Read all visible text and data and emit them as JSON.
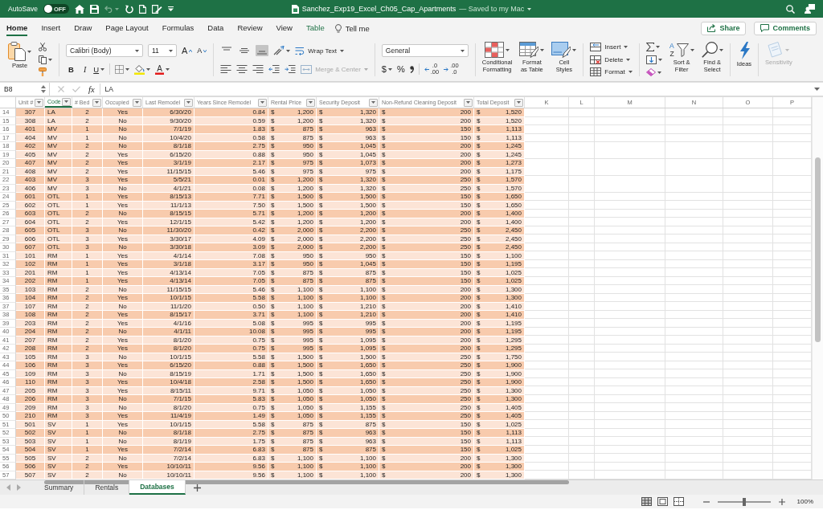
{
  "title_bar": {
    "autosave": {
      "label": "AutoSave",
      "on": false,
      "state_text": "OFF"
    },
    "quick_access": [
      {
        "disabled": false
      },
      {
        "disabled": false
      },
      {
        "disabled": true
      },
      {
        "disabled": false
      },
      {
        "disabled": false
      },
      {
        "disabled": false
      }
    ],
    "document_name": "Sanchez_Exp19_Excel_Ch05_Cap_Apartments",
    "save_status": "— Saved to my Mac"
  },
  "ribbon_tabs": [
    {
      "label": "Home",
      "selected": true,
      "kind": "standard"
    },
    {
      "label": "Insert",
      "selected": false,
      "kind": "standard"
    },
    {
      "label": "Draw",
      "selected": false,
      "kind": "standard"
    },
    {
      "label": "Page Layout",
      "selected": false,
      "kind": "standard"
    },
    {
      "label": "Formulas",
      "selected": false,
      "kind": "standard"
    },
    {
      "label": "Data",
      "selected": false,
      "kind": "standard"
    },
    {
      "label": "Review",
      "selected": false,
      "kind": "standard"
    },
    {
      "label": "View",
      "selected": false,
      "kind": "standard"
    },
    {
      "label": "Table",
      "selected": false,
      "kind": "contextual"
    }
  ],
  "tell_me": "Tell me",
  "share": "Share",
  "comments": "Comments",
  "ribbon": {
    "clipboard": {
      "paste": "Paste"
    },
    "font": {
      "name": "Calibri (Body)",
      "size": "11",
      "grow": "A",
      "shrink": "A",
      "bold": "B",
      "italic": "I",
      "underline": "U",
      "font_color": "A"
    },
    "alignment": {
      "vertical": [
        {
          "selected": false
        },
        {
          "selected": false
        },
        {
          "selected": true
        }
      ],
      "wrap_text": "Wrap Text",
      "merge": {
        "label": "Merge & Center",
        "disabled": true
      }
    },
    "number": {
      "format": "General",
      "currency": "$",
      "percent": "%",
      "decimals": [
        {
          "lines": [
            ".0",
            ".00"
          ]
        },
        {
          "lines": [
            ".00",
            ".0"
          ]
        }
      ]
    },
    "styles": [
      {
        "lines": [
          "Conditional",
          "Formatting"
        ]
      },
      {
        "lines": [
          "Format",
          "as Table"
        ]
      },
      {
        "lines": [
          "Cell",
          "Styles"
        ]
      }
    ],
    "cells": [
      "Insert",
      "Delete",
      "Format"
    ],
    "editing": {
      "sort_letters": [
        "A",
        "Z"
      ],
      "sort": [
        "Sort &",
        "Filter"
      ],
      "find": [
        "Find &",
        "Select"
      ]
    },
    "ideas": "Ideas",
    "sensitivity": {
      "label": "Sensitivity",
      "disabled": true
    }
  },
  "formula_bar": {
    "name_box": "B8",
    "actions": [
      {
        "disabled": true
      },
      {
        "disabled": true
      }
    ],
    "function_label": "fx",
    "formula": "LA"
  },
  "sheet": {
    "columns": [
      {
        "label": "Unit #",
        "kind": "id",
        "selected": false
      },
      {
        "label": "Code",
        "kind": "code",
        "selected": true
      },
      {
        "label": "# Bed",
        "kind": "count",
        "selected": false
      },
      {
        "label": "Occupied",
        "kind": "flag",
        "selected": false
      },
      {
        "label": "Last Remodel",
        "kind": "date",
        "selected": false
      },
      {
        "label": "Years Since Remodel",
        "kind": "decimal",
        "selected": false
      },
      {
        "label": "Rental Price",
        "kind": "currency",
        "selected": false
      },
      {
        "label": "Security Deposit",
        "kind": "currency",
        "selected": false
      },
      {
        "label": "Non-Refund Cleaning Deposit",
        "kind": "currency",
        "selected": false
      },
      {
        "label": "Total Deposit",
        "kind": "currency",
        "selected": false
      }
    ],
    "extra_columns": [
      "K",
      "L",
      "M",
      "N",
      "O",
      "P"
    ],
    "rows": [
      {
        "header": "14",
        "cells": [
          "307",
          "LA",
          "2",
          "Yes",
          "6/30/20",
          "0.84",
          [
            "$",
            "1,200"
          ],
          [
            "$",
            "1,320"
          ],
          [
            "$",
            "200"
          ],
          [
            "$",
            "1,520"
          ]
        ]
      },
      {
        "header": "15",
        "cells": [
          "308",
          "LA",
          "2",
          "No",
          "9/30/20",
          "0.59",
          [
            "$",
            "1,200"
          ],
          [
            "$",
            "1,320"
          ],
          [
            "$",
            "200"
          ],
          [
            "$",
            "1,520"
          ]
        ]
      },
      {
        "header": "16",
        "cells": [
          "401",
          "MV",
          "1",
          "No",
          "7/1/19",
          "1.83",
          [
            "$",
            "875"
          ],
          [
            "$",
            "963"
          ],
          [
            "$",
            "150"
          ],
          [
            "$",
            "1,113"
          ]
        ]
      },
      {
        "header": "17",
        "cells": [
          "404",
          "MV",
          "1",
          "No",
          "10/4/20",
          "0.58",
          [
            "$",
            "875"
          ],
          [
            "$",
            "963"
          ],
          [
            "$",
            "150"
          ],
          [
            "$",
            "1,113"
          ]
        ]
      },
      {
        "header": "18",
        "cells": [
          "402",
          "MV",
          "2",
          "No",
          "8/1/18",
          "2.75",
          [
            "$",
            "950"
          ],
          [
            "$",
            "1,045"
          ],
          [
            "$",
            "200"
          ],
          [
            "$",
            "1,245"
          ]
        ]
      },
      {
        "header": "19",
        "cells": [
          "405",
          "MV",
          "2",
          "Yes",
          "6/15/20",
          "0.88",
          [
            "$",
            "950"
          ],
          [
            "$",
            "1,045"
          ],
          [
            "$",
            "200"
          ],
          [
            "$",
            "1,245"
          ]
        ]
      },
      {
        "header": "20",
        "cells": [
          "407",
          "MV",
          "2",
          "Yes",
          "3/1/19",
          "2.17",
          [
            "$",
            "975"
          ],
          [
            "$",
            "1,073"
          ],
          [
            "$",
            "200"
          ],
          [
            "$",
            "1,273"
          ]
        ]
      },
      {
        "header": "21",
        "cells": [
          "408",
          "MV",
          "2",
          "Yes",
          "11/15/15",
          "5.46",
          [
            "$",
            "975"
          ],
          [
            "$",
            "975"
          ],
          [
            "$",
            "200"
          ],
          [
            "$",
            "1,175"
          ]
        ]
      },
      {
        "header": "22",
        "cells": [
          "403",
          "MV",
          "3",
          "Yes",
          "5/5/21",
          "0.01",
          [
            "$",
            "1,200"
          ],
          [
            "$",
            "1,320"
          ],
          [
            "$",
            "250"
          ],
          [
            "$",
            "1,570"
          ]
        ]
      },
      {
        "header": "23",
        "cells": [
          "406",
          "MV",
          "3",
          "No",
          "4/1/21",
          "0.08",
          [
            "$",
            "1,200"
          ],
          [
            "$",
            "1,320"
          ],
          [
            "$",
            "250"
          ],
          [
            "$",
            "1,570"
          ]
        ]
      },
      {
        "header": "24",
        "cells": [
          "601",
          "OTL",
          "1",
          "Yes",
          "8/15/13",
          "7.71",
          [
            "$",
            "1,500"
          ],
          [
            "$",
            "1,500"
          ],
          [
            "$",
            "150"
          ],
          [
            "$",
            "1,650"
          ]
        ]
      },
      {
        "header": "25",
        "cells": [
          "602",
          "OTL",
          "1",
          "Yes",
          "11/1/13",
          "7.50",
          [
            "$",
            "1,500"
          ],
          [
            "$",
            "1,500"
          ],
          [
            "$",
            "150"
          ],
          [
            "$",
            "1,650"
          ]
        ]
      },
      {
        "header": "26",
        "cells": [
          "603",
          "OTL",
          "2",
          "No",
          "8/15/15",
          "5.71",
          [
            "$",
            "1,200"
          ],
          [
            "$",
            "1,200"
          ],
          [
            "$",
            "200"
          ],
          [
            "$",
            "1,400"
          ]
        ]
      },
      {
        "header": "27",
        "cells": [
          "604",
          "OTL",
          "2",
          "Yes",
          "12/1/15",
          "5.42",
          [
            "$",
            "1,200"
          ],
          [
            "$",
            "1,200"
          ],
          [
            "$",
            "200"
          ],
          [
            "$",
            "1,400"
          ]
        ]
      },
      {
        "header": "28",
        "cells": [
          "605",
          "OTL",
          "3",
          "No",
          "11/30/20",
          "0.42",
          [
            "$",
            "2,000"
          ],
          [
            "$",
            "2,200"
          ],
          [
            "$",
            "250"
          ],
          [
            "$",
            "2,450"
          ]
        ]
      },
      {
        "header": "29",
        "cells": [
          "606",
          "OTL",
          "3",
          "Yes",
          "3/30/17",
          "4.09",
          [
            "$",
            "2,000"
          ],
          [
            "$",
            "2,200"
          ],
          [
            "$",
            "250"
          ],
          [
            "$",
            "2,450"
          ]
        ]
      },
      {
        "header": "30",
        "cells": [
          "607",
          "OTL",
          "3",
          "No",
          "3/30/18",
          "3.09",
          [
            "$",
            "2,000"
          ],
          [
            "$",
            "2,200"
          ],
          [
            "$",
            "250"
          ],
          [
            "$",
            "2,450"
          ]
        ]
      },
      {
        "header": "31",
        "cells": [
          "101",
          "RM",
          "1",
          "Yes",
          "4/1/14",
          "7.08",
          [
            "$",
            "950"
          ],
          [
            "$",
            "950"
          ],
          [
            "$",
            "150"
          ],
          [
            "$",
            "1,100"
          ]
        ]
      },
      {
        "header": "32",
        "cells": [
          "102",
          "RM",
          "1",
          "Yes",
          "3/1/18",
          "3.17",
          [
            "$",
            "950"
          ],
          [
            "$",
            "1,045"
          ],
          [
            "$",
            "150"
          ],
          [
            "$",
            "1,195"
          ]
        ]
      },
      {
        "header": "33",
        "cells": [
          "201",
          "RM",
          "1",
          "Yes",
          "4/13/14",
          "7.05",
          [
            "$",
            "875"
          ],
          [
            "$",
            "875"
          ],
          [
            "$",
            "150"
          ],
          [
            "$",
            "1,025"
          ]
        ]
      },
      {
        "header": "34",
        "cells": [
          "202",
          "RM",
          "1",
          "Yes",
          "4/13/14",
          "7.05",
          [
            "$",
            "875"
          ],
          [
            "$",
            "875"
          ],
          [
            "$",
            "150"
          ],
          [
            "$",
            "1,025"
          ]
        ]
      },
      {
        "header": "35",
        "cells": [
          "103",
          "RM",
          "2",
          "No",
          "11/15/15",
          "5.46",
          [
            "$",
            "1,100"
          ],
          [
            "$",
            "1,100"
          ],
          [
            "$",
            "200"
          ],
          [
            "$",
            "1,300"
          ]
        ]
      },
      {
        "header": "36",
        "cells": [
          "104",
          "RM",
          "2",
          "Yes",
          "10/1/15",
          "5.58",
          [
            "$",
            "1,100"
          ],
          [
            "$",
            "1,100"
          ],
          [
            "$",
            "200"
          ],
          [
            "$",
            "1,300"
          ]
        ]
      },
      {
        "header": "37",
        "cells": [
          "107",
          "RM",
          "2",
          "No",
          "11/1/20",
          "0.50",
          [
            "$",
            "1,100"
          ],
          [
            "$",
            "1,210"
          ],
          [
            "$",
            "200"
          ],
          [
            "$",
            "1,410"
          ]
        ]
      },
      {
        "header": "38",
        "cells": [
          "108",
          "RM",
          "2",
          "Yes",
          "8/15/17",
          "3.71",
          [
            "$",
            "1,100"
          ],
          [
            "$",
            "1,210"
          ],
          [
            "$",
            "200"
          ],
          [
            "$",
            "1,410"
          ]
        ]
      },
      {
        "header": "39",
        "cells": [
          "203",
          "RM",
          "2",
          "Yes",
          "4/1/16",
          "5.08",
          [
            "$",
            "995"
          ],
          [
            "$",
            "995"
          ],
          [
            "$",
            "200"
          ],
          [
            "$",
            "1,195"
          ]
        ]
      },
      {
        "header": "40",
        "cells": [
          "204",
          "RM",
          "2",
          "No",
          "4/1/11",
          "10.08",
          [
            "$",
            "995"
          ],
          [
            "$",
            "995"
          ],
          [
            "$",
            "200"
          ],
          [
            "$",
            "1,195"
          ]
        ]
      },
      {
        "header": "41",
        "cells": [
          "207",
          "RM",
          "2",
          "Yes",
          "8/1/20",
          "0.75",
          [
            "$",
            "995"
          ],
          [
            "$",
            "1,095"
          ],
          [
            "$",
            "200"
          ],
          [
            "$",
            "1,295"
          ]
        ]
      },
      {
        "header": "42",
        "cells": [
          "208",
          "RM",
          "2",
          "Yes",
          "8/1/20",
          "0.75",
          [
            "$",
            "995"
          ],
          [
            "$",
            "1,095"
          ],
          [
            "$",
            "200"
          ],
          [
            "$",
            "1,295"
          ]
        ]
      },
      {
        "header": "43",
        "cells": [
          "105",
          "RM",
          "3",
          "No",
          "10/1/15",
          "5.58",
          [
            "$",
            "1,500"
          ],
          [
            "$",
            "1,500"
          ],
          [
            "$",
            "250"
          ],
          [
            "$",
            "1,750"
          ]
        ]
      },
      {
        "header": "44",
        "cells": [
          "106",
          "RM",
          "3",
          "Yes",
          "6/15/20",
          "0.88",
          [
            "$",
            "1,500"
          ],
          [
            "$",
            "1,650"
          ],
          [
            "$",
            "250"
          ],
          [
            "$",
            "1,900"
          ]
        ]
      },
      {
        "header": "45",
        "cells": [
          "109",
          "RM",
          "3",
          "No",
          "8/15/19",
          "1.71",
          [
            "$",
            "1,500"
          ],
          [
            "$",
            "1,650"
          ],
          [
            "$",
            "250"
          ],
          [
            "$",
            "1,900"
          ]
        ]
      },
      {
        "header": "46",
        "cells": [
          "110",
          "RM",
          "3",
          "Yes",
          "10/4/18",
          "2.58",
          [
            "$",
            "1,500"
          ],
          [
            "$",
            "1,650"
          ],
          [
            "$",
            "250"
          ],
          [
            "$",
            "1,900"
          ]
        ]
      },
      {
        "header": "47",
        "cells": [
          "205",
          "RM",
          "3",
          "Yes",
          "8/15/11",
          "9.71",
          [
            "$",
            "1,050"
          ],
          [
            "$",
            "1,050"
          ],
          [
            "$",
            "250"
          ],
          [
            "$",
            "1,300"
          ]
        ]
      },
      {
        "header": "48",
        "cells": [
          "206",
          "RM",
          "3",
          "No",
          "7/1/15",
          "5.83",
          [
            "$",
            "1,050"
          ],
          [
            "$",
            "1,050"
          ],
          [
            "$",
            "250"
          ],
          [
            "$",
            "1,300"
          ]
        ]
      },
      {
        "header": "49",
        "cells": [
          "209",
          "RM",
          "3",
          "No",
          "8/1/20",
          "0.75",
          [
            "$",
            "1,050"
          ],
          [
            "$",
            "1,155"
          ],
          [
            "$",
            "250"
          ],
          [
            "$",
            "1,405"
          ]
        ]
      },
      {
        "header": "50",
        "cells": [
          "210",
          "RM",
          "3",
          "Yes",
          "11/4/19",
          "1.49",
          [
            "$",
            "1,050"
          ],
          [
            "$",
            "1,155"
          ],
          [
            "$",
            "250"
          ],
          [
            "$",
            "1,405"
          ]
        ]
      },
      {
        "header": "51",
        "cells": [
          "501",
          "SV",
          "1",
          "Yes",
          "10/1/15",
          "5.58",
          [
            "$",
            "875"
          ],
          [
            "$",
            "875"
          ],
          [
            "$",
            "150"
          ],
          [
            "$",
            "1,025"
          ]
        ]
      },
      {
        "header": "52",
        "cells": [
          "502",
          "SV",
          "1",
          "No",
          "8/1/18",
          "2.75",
          [
            "$",
            "875"
          ],
          [
            "$",
            "963"
          ],
          [
            "$",
            "150"
          ],
          [
            "$",
            "1,113"
          ]
        ]
      },
      {
        "header": "53",
        "cells": [
          "503",
          "SV",
          "1",
          "No",
          "8/1/19",
          "1.75",
          [
            "$",
            "875"
          ],
          [
            "$",
            "963"
          ],
          [
            "$",
            "150"
          ],
          [
            "$",
            "1,113"
          ]
        ]
      },
      {
        "header": "54",
        "cells": [
          "504",
          "SV",
          "1",
          "Yes",
          "7/2/14",
          "6.83",
          [
            "$",
            "875"
          ],
          [
            "$",
            "875"
          ],
          [
            "$",
            "150"
          ],
          [
            "$",
            "1,025"
          ]
        ]
      },
      {
        "header": "55",
        "cells": [
          "505",
          "SV",
          "2",
          "No",
          "7/2/14",
          "6.83",
          [
            "$",
            "1,100"
          ],
          [
            "$",
            "1,100"
          ],
          [
            "$",
            "200"
          ],
          [
            "$",
            "1,300"
          ]
        ]
      },
      {
        "header": "56",
        "cells": [
          "506",
          "SV",
          "2",
          "Yes",
          "10/10/11",
          "9.56",
          [
            "$",
            "1,100"
          ],
          [
            "$",
            "1,100"
          ],
          [
            "$",
            "200"
          ],
          [
            "$",
            "1,300"
          ]
        ]
      },
      {
        "header": "57",
        "cells": [
          "507",
          "SV",
          "2",
          "No",
          "10/10/11",
          "9.56",
          [
            "$",
            "1,100"
          ],
          [
            "$",
            "1,100"
          ],
          [
            "$",
            "200"
          ],
          [
            "$",
            "1,300"
          ]
        ]
      }
    ]
  },
  "sheet_tabs": [
    {
      "label": "Summary",
      "selected": false
    },
    {
      "label": "Rentals",
      "selected": false
    },
    {
      "label": "Databases",
      "selected": true
    }
  ],
  "status_bar": {
    "views": [
      {
        "selected": true
      },
      {
        "selected": false
      },
      {
        "selected": false
      }
    ],
    "zoom": {
      "level": 0.5,
      "reading": "100%"
    }
  }
}
